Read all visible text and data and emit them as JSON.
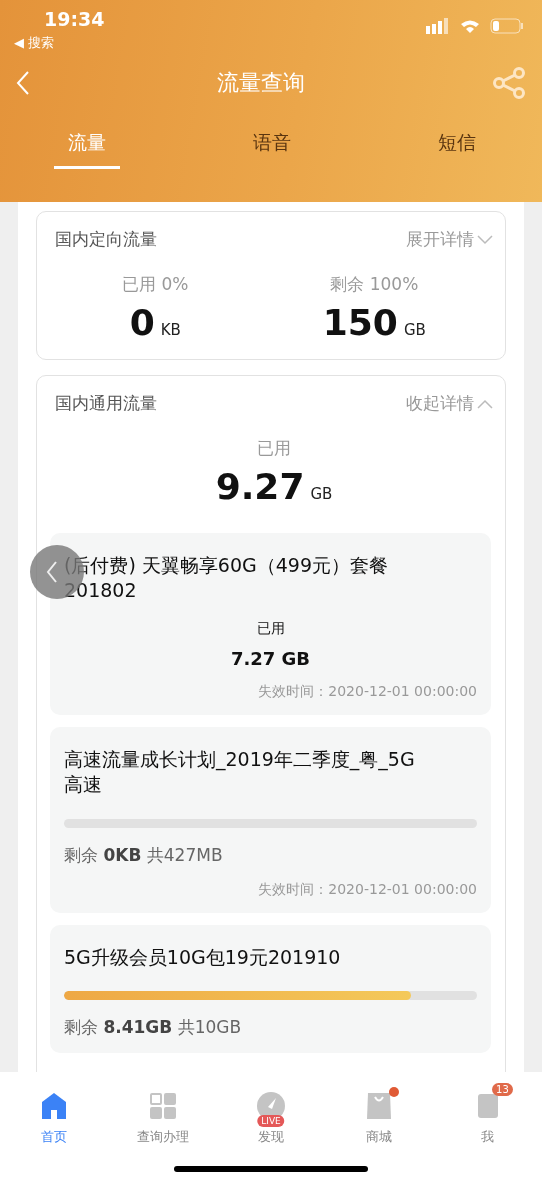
{
  "status_bar": {
    "time": "19:34",
    "back_app": "◀ 搜索"
  },
  "nav_bar": {
    "title": "流量查询"
  },
  "tabs": [
    {
      "label": "流量",
      "selected": true
    },
    {
      "label": "语音",
      "selected": false
    },
    {
      "label": "短信",
      "selected": false
    }
  ],
  "cards": [
    {
      "title": "国内定向流量",
      "toggle": "展开详情",
      "expanded": false,
      "stats": [
        {
          "label": "已用 0%",
          "value": "0",
          "unit": "KB"
        },
        {
          "label": "剩余 100%",
          "value": "150",
          "unit": "GB"
        }
      ]
    },
    {
      "title": "国内通用流量",
      "toggle": "收起详情",
      "expanded": true,
      "stats": [
        {
          "label": "已用",
          "value": "9.27",
          "unit": "GB"
        }
      ],
      "packages": [
        {
          "kind": "used",
          "name": "(后付费) 天翼畅享60G（499元）套餐201802",
          "used_label": "已用",
          "used_value": "7.27 GB",
          "expiry": "失效时间：2020-12-01 00:00:00"
        },
        {
          "kind": "progress",
          "name": "高速流量成长计划_2019年二季度_粤_5G高速",
          "level": 0,
          "remain_prefix": "剩余",
          "remain_value": "0KB",
          "total": "共427MB",
          "expiry": "失效时间：2020-12-01 00:00:00"
        },
        {
          "kind": "progress",
          "name": "5G升级会员10G包19元201910",
          "level": 0.84,
          "remain_prefix": "剩余",
          "remain_value": "8.41GB",
          "total": "共10GB"
        }
      ]
    }
  ],
  "bottom_nav": [
    {
      "label": "首页",
      "selected": true
    },
    {
      "label": "查询办理",
      "selected": false
    },
    {
      "label": "发现",
      "selected": false,
      "badge": "LIVE"
    },
    {
      "label": "商城",
      "selected": false,
      "dot": true
    },
    {
      "label": "我",
      "selected": false,
      "badge": "13"
    }
  ]
}
